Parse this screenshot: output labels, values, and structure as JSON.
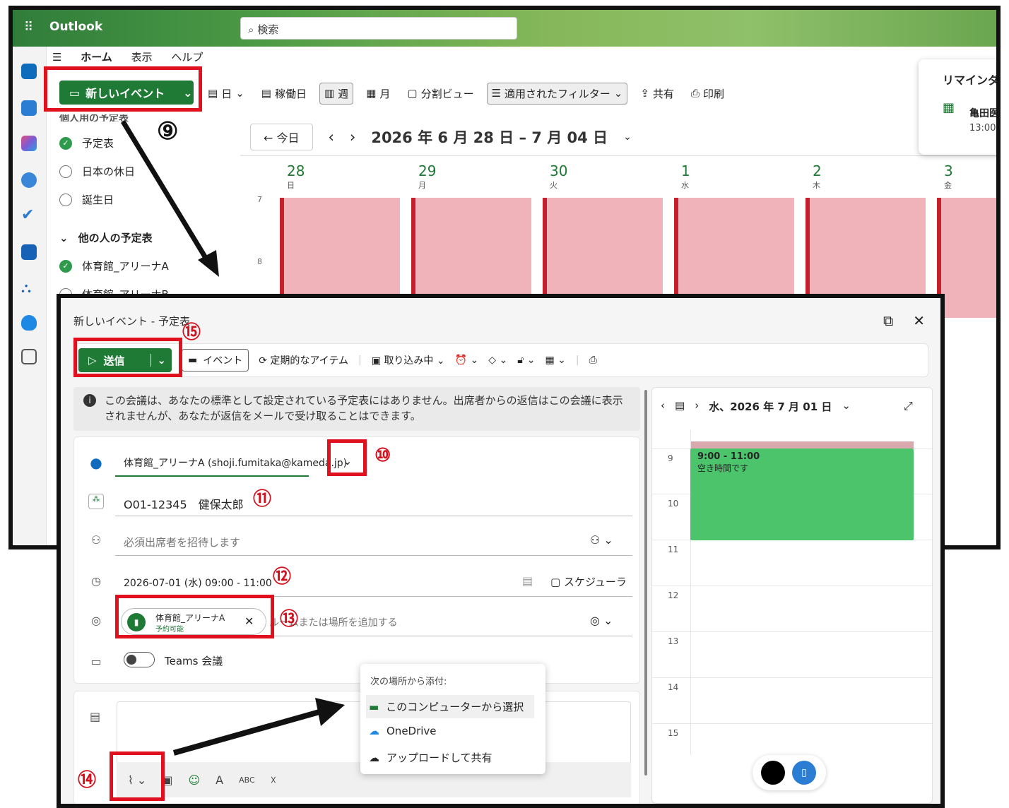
{
  "outlook": {
    "app_name": "Outlook",
    "search_placeholder": "検索",
    "menu": [
      "ホーム",
      "表示",
      "ヘルプ"
    ],
    "new_event_label": "新しいイベント",
    "toolbar": {
      "day": "日",
      "workweek": "稼働日",
      "week": "週",
      "month": "月",
      "split": "分割ビュー",
      "filter": "適用されたフィルター",
      "share": "共有",
      "print": "印刷"
    },
    "nav": {
      "today": "今日",
      "range": "2026 年 6 月 28 日 – 7 月 04 日"
    },
    "calendars": {
      "cut_header": "個人用の予定表",
      "mine": [
        "予定表",
        "日本の休日",
        "誕生日"
      ],
      "others_header": "他の人の予定表",
      "others": [
        "体育館_アリーナA",
        "体育館_アリーナB"
      ]
    },
    "days": [
      {
        "num": "28",
        "dow": "日"
      },
      {
        "num": "29",
        "dow": "月"
      },
      {
        "num": "30",
        "dow": "火"
      },
      {
        "num": "1",
        "dow": "水"
      },
      {
        "num": "2",
        "dow": "木"
      },
      {
        "num": "3",
        "dow": "金"
      }
    ],
    "hours": [
      "7",
      "8"
    ],
    "reminder": {
      "title": "リマインダ",
      "item": "亀田医",
      "time": "13:00"
    }
  },
  "dialog": {
    "title": "新しいイベント - 予定表",
    "send_label": "送信",
    "event_label": "イベント",
    "recurring_label": "定期的なアイテム",
    "busy_label": "取り込み中",
    "info": "この会議は、あなたの標準として設定されている予定表にはありません。出席者からの返信はこの会議に表示されませんが、あなたが返信をメールで受け取ることはできます。",
    "calendar_select": "体育館_アリーナA (shoji.fumitaka@kameda.jp)",
    "event_title": "O01-12345　健保太郎",
    "attendees_placeholder": "必須出席者を招待します",
    "datetime": "2026-07-01 (水) 09:00 - 11:00",
    "scheduler_label": "スケジューラ",
    "location_chip": {
      "name": "体育館_アリーナA",
      "status": "予約可能"
    },
    "location_placeholder": "ルームまたは場所を追加する",
    "teams_label": "Teams 会議",
    "attach_menu": {
      "header": "次の場所から添付:",
      "items": [
        "このコンピューターから選択",
        "OneDrive",
        "アップロードして共有"
      ]
    },
    "side_cal": {
      "date": "水、2026 年 7 月 01 日",
      "hours": [
        "9",
        "10",
        "11",
        "12",
        "13",
        "14",
        "15"
      ],
      "event_time": "9:00 - 11:00",
      "event_status": "空き時間です"
    }
  },
  "annotations": {
    "c9": "⑨",
    "c10": "⑩",
    "c11": "⑪",
    "c12": "⑫",
    "c13": "⑬",
    "c14": "⑭",
    "c15": "⑮"
  },
  "colors": {
    "brand_green": "#1f7a35",
    "highlight_red": "#e0101e",
    "busy_pink": "#f0b3ba",
    "free_green": "#4cc46b"
  }
}
